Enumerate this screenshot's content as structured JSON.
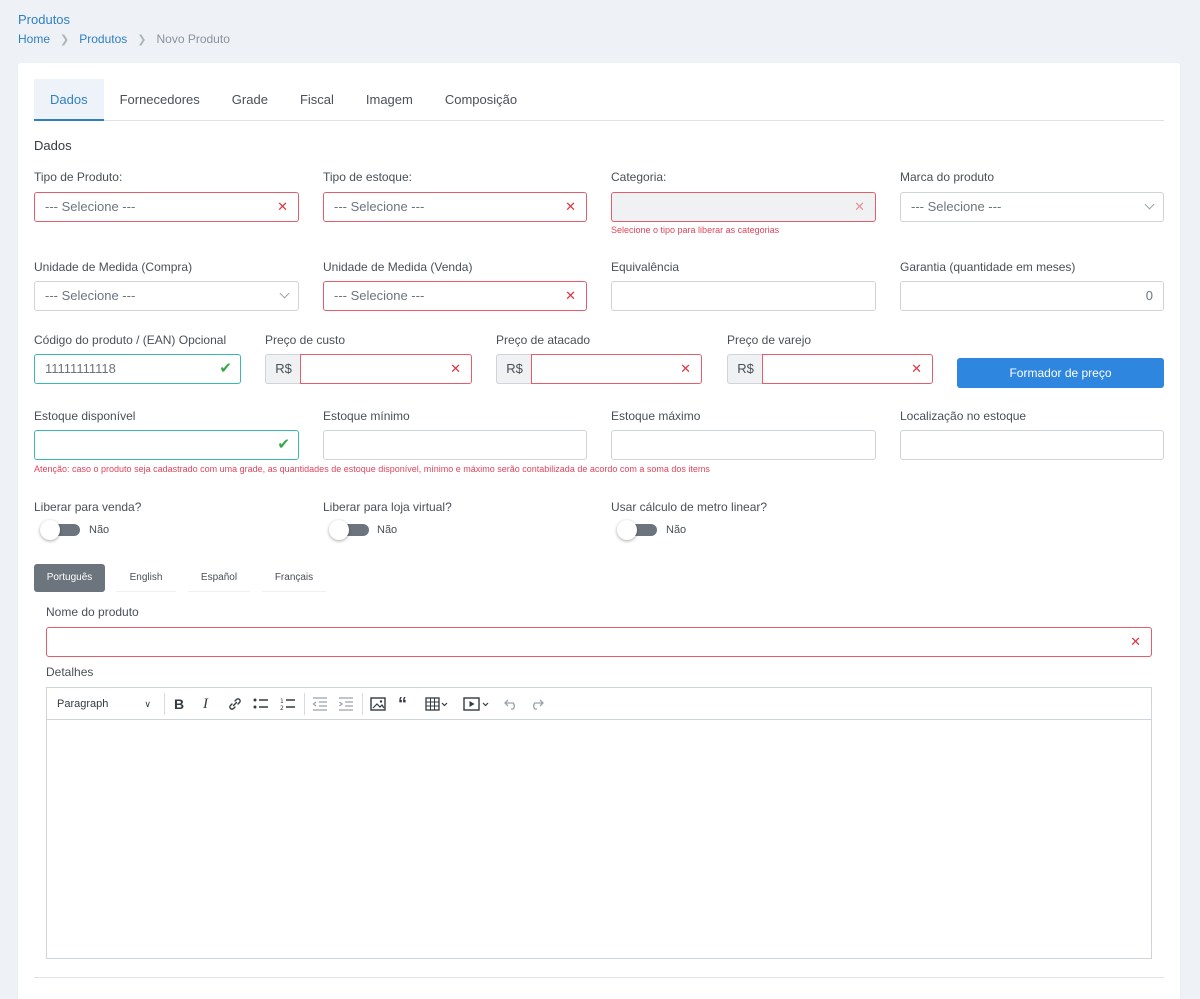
{
  "header": {
    "title": "Produtos",
    "breadcrumb": [
      "Home",
      "Produtos",
      "Novo Produto"
    ]
  },
  "tabs": [
    "Dados",
    "Fornecedores",
    "Grade",
    "Fiscal",
    "Imagem",
    "Composição"
  ],
  "section_title": "Dados",
  "fields": {
    "tipo_produto": {
      "label": "Tipo de Produto:",
      "value": "--- Selecione ---"
    },
    "tipo_estoque": {
      "label": "Tipo de estoque:",
      "value": "--- Selecione ---"
    },
    "categoria": {
      "label": "Categoria:",
      "hint": "Selecione o tipo para liberar as categorias"
    },
    "marca": {
      "label": "Marca do produto",
      "value": "--- Selecione ---"
    },
    "unidade_compra": {
      "label": "Unidade de Medida (Compra)",
      "value": "--- Selecione ---"
    },
    "unidade_venda": {
      "label": "Unidade de Medida (Venda)",
      "value": "--- Selecione ---"
    },
    "equivalencia": {
      "label": "Equivalência",
      "value": ""
    },
    "garantia": {
      "label": "Garantia (quantidade em meses)",
      "value": "0"
    },
    "codigo": {
      "label": "Código do produto / (EAN) Opcional",
      "value": "11111111118"
    },
    "preco_custo": {
      "label": "Preço de custo",
      "prefix": "R$"
    },
    "preco_atacado": {
      "label": "Preço de atacado",
      "prefix": "R$"
    },
    "preco_varejo": {
      "label": "Preço de varejo",
      "prefix": "R$"
    },
    "formador_button": "Formador de preço",
    "estoque_disponivel": {
      "label": "Estoque disponível",
      "value": ""
    },
    "estoque_minimo": {
      "label": "Estoque mínimo",
      "value": ""
    },
    "estoque_maximo": {
      "label": "Estoque máximo",
      "value": ""
    },
    "localizacao": {
      "label": "Localização no estoque",
      "value": ""
    },
    "estoque_warning": "Atenção: caso o produto seja cadastrado com uma grade, as quantidades de estoque disponível, mínimo e máximo serão contabilizada de acordo com a soma dos items"
  },
  "toggles": [
    {
      "label": "Liberar para venda?",
      "state": "Não"
    },
    {
      "label": "Liberar para loja virtual?",
      "state": "Não"
    },
    {
      "label": "Usar cálculo de metro linear?",
      "state": "Não"
    }
  ],
  "languages": [
    "Português",
    "English",
    "Español",
    "Français"
  ],
  "nome_produto": {
    "label": "Nome do produto",
    "value": ""
  },
  "detalhes": {
    "label": "Detalhes",
    "block_format": "Paragraph"
  },
  "colors": {
    "accent": "#2f7fc1",
    "primary_button": "#2e86de",
    "error": "#dc3545",
    "success": "#37a847"
  }
}
